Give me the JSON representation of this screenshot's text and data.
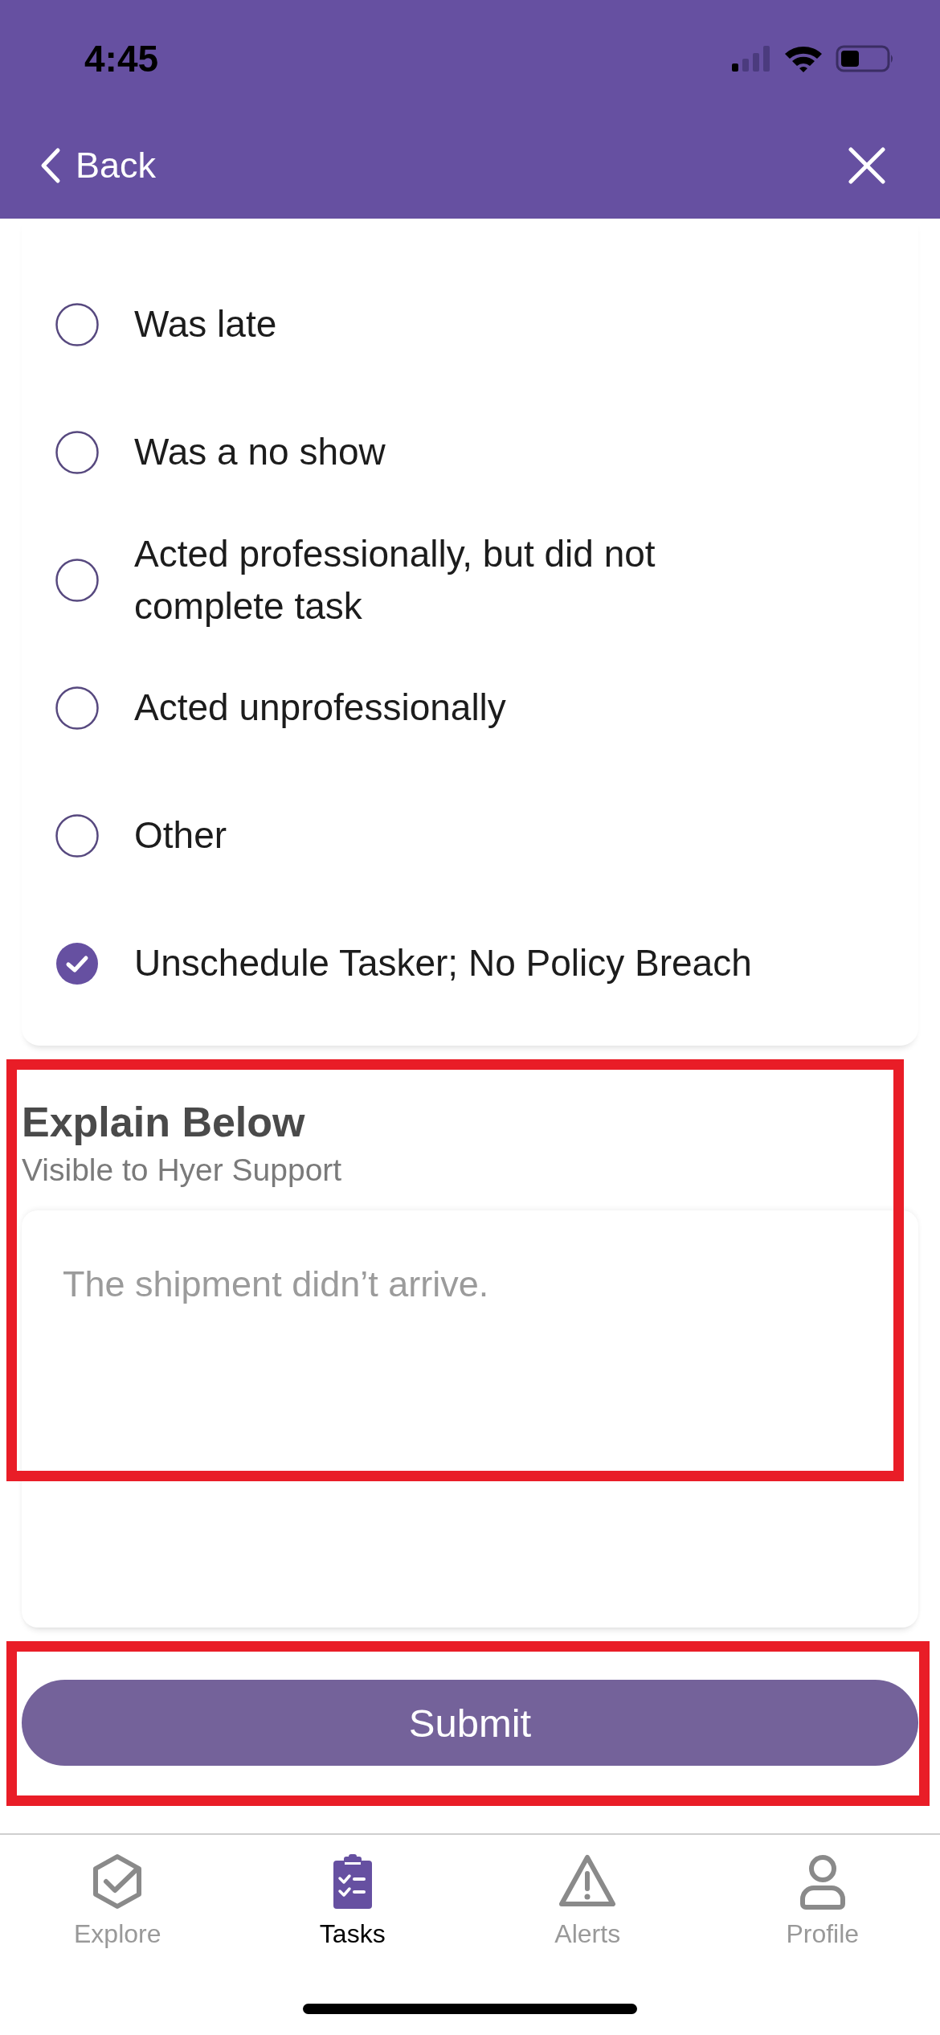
{
  "status_bar": {
    "time": "4:45"
  },
  "header": {
    "back_label": "Back"
  },
  "options": [
    {
      "label": "Was late",
      "selected": false
    },
    {
      "label": "Was a no show",
      "selected": false
    },
    {
      "label": "Acted professionally, but did not complete task",
      "selected": false
    },
    {
      "label": "Acted unprofessionally",
      "selected": false
    },
    {
      "label": "Other",
      "selected": false
    },
    {
      "label": "Unschedule Tasker; No Policy Breach",
      "selected": true
    }
  ],
  "explain": {
    "title": "Explain Below",
    "subtitle": "Visible to Hyer Support",
    "value": "The shipment didn’t arrive.",
    "highlighted": true
  },
  "submit": {
    "label": "Submit",
    "highlighted": true
  },
  "tab_bar": [
    {
      "label": "Explore",
      "selected": false
    },
    {
      "label": "Tasks",
      "selected": true
    },
    {
      "label": "Alerts",
      "selected": false
    },
    {
      "label": "Profile",
      "selected": false
    }
  ]
}
